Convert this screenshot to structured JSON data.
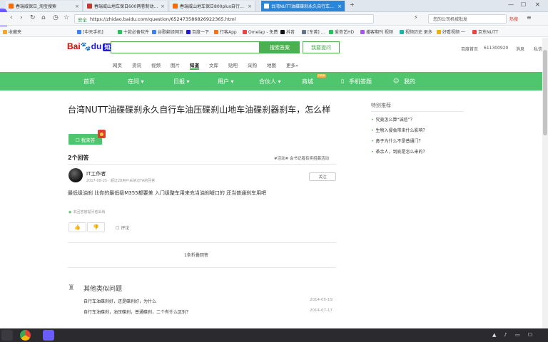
{
  "browser": {
    "tabs": [
      {
        "title": "春瑞威保日_淘宝搜索",
        "active": false,
        "color": "#ff6a00"
      },
      {
        "title": "春瑞威山地车保日600两卷制动…",
        "active": false,
        "color": "#c0392b"
      },
      {
        "title": "春瑞威山地车保日800plus自行…",
        "active": false,
        "color": "#ff6a00"
      },
      {
        "title": "台湾NUTT油碟碟刹永久自行车…",
        "active": true,
        "color": "#ffffff"
      }
    ],
    "new_tab": "+",
    "url": "https://zhidao.baidu.com/question/652473586826922365.html",
    "safe_label": "安全",
    "right_search_placeholder": "您的公司机械批发",
    "hot_label": "热搜",
    "window_controls": [
      "—",
      "☐",
      "✕"
    ]
  },
  "bookmarks": [
    {
      "label": "收藏夹",
      "color": "#f5a623"
    },
    {
      "label": "[中天手机]",
      "color": "#3b82f6"
    },
    {
      "label": "十款必备软件",
      "color": "#22c55e"
    },
    {
      "label": "谷歌翻译网页",
      "color": "#3b82f6"
    },
    {
      "label": "百度一下",
      "color": "#2319dc"
    },
    {
      "label": "行客App",
      "color": "#f97316"
    },
    {
      "label": "Omelap - 免费",
      "color": "#ef4444"
    },
    {
      "label": "抖音",
      "color": "#111111"
    },
    {
      "label": "[东菁] …",
      "color": "#64748b"
    },
    {
      "label": "爱奇艺HD",
      "color": "#22c55e"
    },
    {
      "label": "播客期刊 视频",
      "color": "#a855f7"
    },
    {
      "label": "视频历史 更多",
      "color": "#14b8a6"
    },
    {
      "label": "好看视频 一",
      "color": "#eab308"
    },
    {
      "label": "京东NUTT",
      "color": "#ef4444"
    }
  ],
  "baidu": {
    "logo_text_1": "Bai",
    "logo_text_2": "du",
    "logo_zhidao": "知道",
    "search_button": "搜索答案",
    "ask_button": "我要提问",
    "top_links": [
      "百度首页",
      "611300920",
      "消息",
      "私信"
    ],
    "nav": [
      "网页",
      "资讯",
      "视频",
      "图片",
      "知道",
      "文库",
      "贴吧",
      "采购",
      "地图",
      "更多»"
    ],
    "nav_selected": "知道"
  },
  "menu": {
    "items": [
      "首页",
      "在问 ▾",
      "日报 ▾",
      "用户 ▾",
      "合伙人 ▾",
      "商城",
      "手机答题",
      "我的"
    ],
    "new_tag": "new"
  },
  "question": {
    "title": "台湾NUTT油碟碟刹永久自行车油压碟刹山地车油碟刹器刹车，怎么样",
    "answer_button": "☐ 我来答",
    "answers_count": "2个回答",
    "sort_label": "#活动# 会书记者有奖招募活动"
  },
  "answer": {
    "username": "IT工作者",
    "meta": "2017-08-25 · 超过28用户采纳过TA的回答",
    "follow": "关注",
    "text": "最低级油刹 比你的最低级M355都要差 入门级整车用来充当油刹噱口的 还当普通刹车用吧",
    "verified": "本回答被提问者采纳",
    "like": "👍",
    "dislike": "👎",
    "comment": "☐ 评论",
    "folded": "1条折叠回答"
  },
  "similar": {
    "title": "其他类似问题",
    "items": [
      {
        "q": "自行车油碟刹好，还是碟刹好，为什么",
        "date": "2014-05-19"
      },
      {
        "q": "自行车油碟刹，油压碟刹，普通碟刹，二个有什么区别？",
        "date": "2014-07-17"
      }
    ]
  },
  "sidebar": {
    "title": "特别推荐",
    "items": [
      "究竟怎么算“诚信”？",
      "生物入侵会带来什么影响？",
      "鼻子为什么不是普通门？",
      "茶余人，到底是怎么来的？"
    ]
  }
}
